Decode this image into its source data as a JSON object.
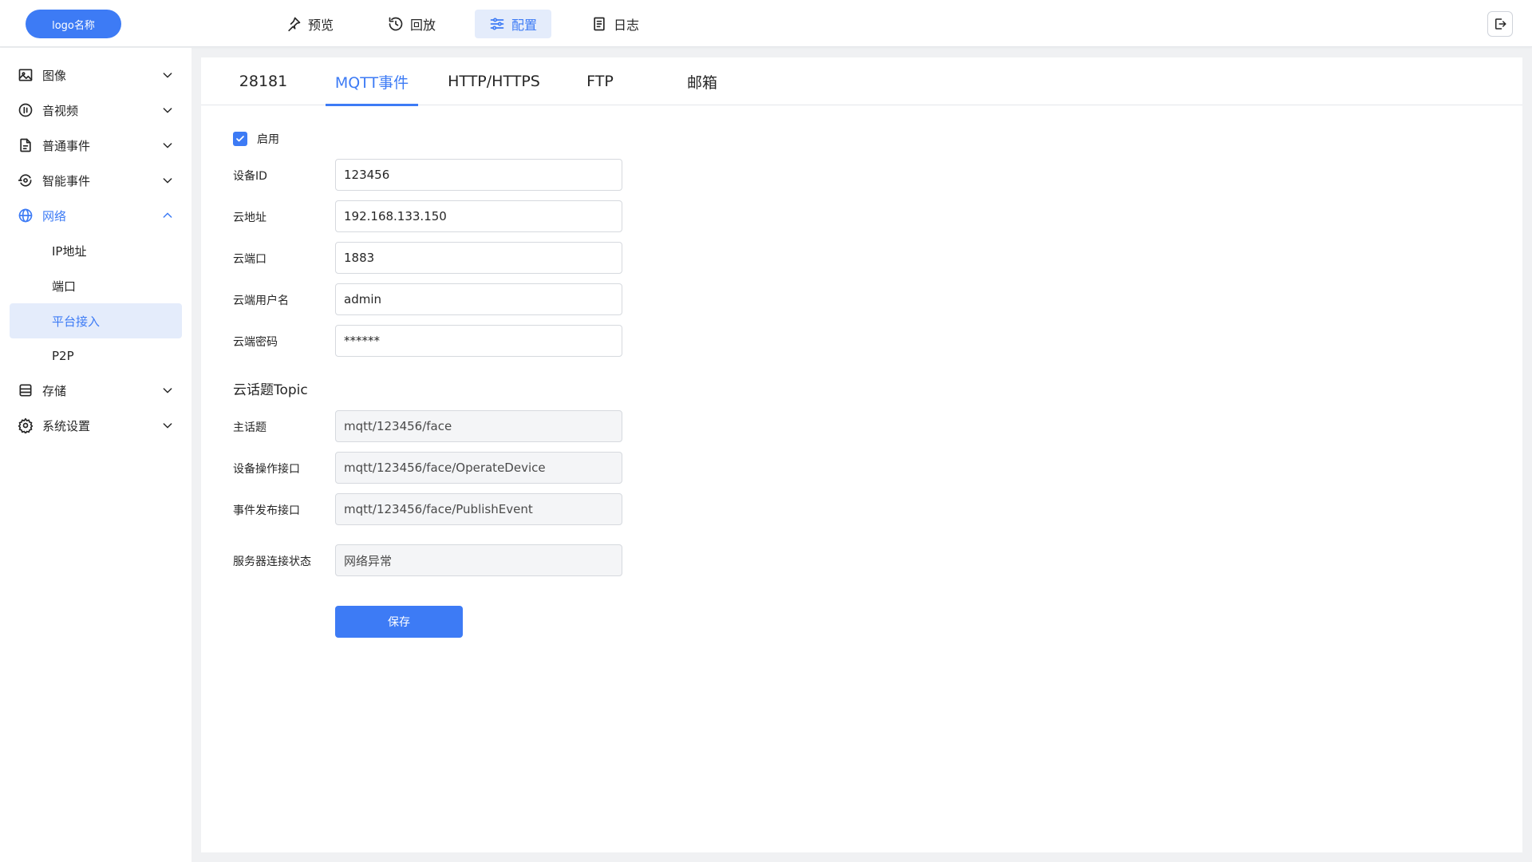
{
  "header": {
    "logo": "logo名称",
    "nav": [
      {
        "label": "预览",
        "icon": "pin-icon"
      },
      {
        "label": "回放",
        "icon": "replay-icon"
      },
      {
        "label": "配置",
        "icon": "sliders-icon"
      },
      {
        "label": "日志",
        "icon": "log-icon"
      }
    ],
    "active_nav": "配置",
    "logout_icon": "logout-icon"
  },
  "sidebar": {
    "items": [
      {
        "label": "图像",
        "icon": "image-icon"
      },
      {
        "label": "音视频",
        "icon": "audio-video-icon"
      },
      {
        "label": "普通事件",
        "icon": "document-icon"
      },
      {
        "label": "智能事件",
        "icon": "smart-icon"
      },
      {
        "label": "网络",
        "icon": "globe-icon",
        "expanded": true
      },
      {
        "label": "存储",
        "icon": "storage-icon"
      },
      {
        "label": "系统设置",
        "icon": "gear-icon"
      }
    ],
    "network_children": [
      "IP地址",
      "端口",
      "平台接入",
      "P2P"
    ],
    "active_child": "平台接入"
  },
  "tabs": [
    "28181",
    "MQTT事件",
    "HTTP/HTTPS",
    "FTP",
    "邮箱"
  ],
  "active_tab": "MQTT事件",
  "form": {
    "enable_label": "启用",
    "enabled": true,
    "device_id": {
      "label": "设备ID",
      "value": "123456"
    },
    "cloud_address": {
      "label": "云地址",
      "value": "192.168.133.150"
    },
    "cloud_port": {
      "label": "云端口",
      "value": "1883"
    },
    "cloud_username": {
      "label": "云端用户名",
      "value": "admin"
    },
    "cloud_password": {
      "label": "云端密码",
      "value": "******"
    },
    "topic_section_title": "云话题Topic",
    "main_topic": {
      "label": "主话题",
      "value": "mqtt/123456/face"
    },
    "operate_topic": {
      "label": "设备操作接口",
      "value": "mqtt/123456/face/OperateDevice"
    },
    "publish_topic": {
      "label": "事件发布接口",
      "value": "mqtt/123456/face/PublishEvent"
    },
    "server_status": {
      "label": "服务器连接状态",
      "value": "网络异常"
    },
    "save_label": "保存"
  },
  "colors": {
    "accent": "#3d7bf5",
    "accent_light": "#e4ecfb",
    "background": "#f0f1f3"
  }
}
